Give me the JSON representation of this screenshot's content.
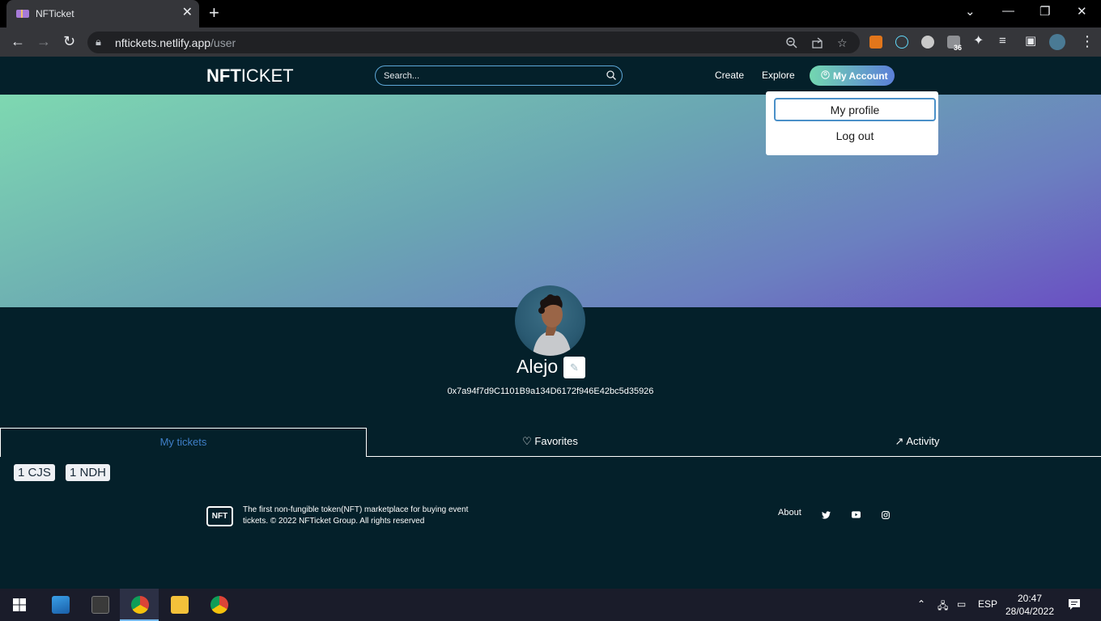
{
  "browser": {
    "tab_title": "NFTicket",
    "tab_close": "✕",
    "new_tab": "+",
    "url_host": "nftickets.netlify.app",
    "url_path": "/user",
    "extension_badge": "36"
  },
  "site": {
    "logo_bold": "NFT",
    "logo_rest": "ICKET",
    "search_placeholder": "Search...",
    "nav": {
      "create": "Create",
      "explore": "Explore",
      "account": "My Account"
    },
    "dropdown": {
      "my_profile": "My profile",
      "log_out": "Log out"
    },
    "profile": {
      "name": "Alejo",
      "edit_glyph": "✎",
      "address": "0x7a94f7d9C1101B9a134D6172f946E42bc5d35926"
    },
    "tabs": {
      "my_tickets": "My tickets",
      "favorites": "Favorites",
      "activity": "Activity",
      "favorites_icon": "♡",
      "activity_icon": "↗"
    },
    "tickets": [
      "1 CJS",
      "1 NDH"
    ],
    "footer": {
      "logo": "NFT",
      "text": "The first non-fungible token(NFT) marketplace for buying event tickets. © 2022 NFTicket Group. All rights reserved",
      "about": "About"
    }
  },
  "taskbar": {
    "language": "ESP",
    "time": "20:47",
    "date": "28/04/2022"
  },
  "colors": {
    "page_bg": "#04202a",
    "accent_blue": "#3f7fc8",
    "account_gradient_start": "#73d7b0",
    "account_gradient_end": "#5b7fd8"
  }
}
